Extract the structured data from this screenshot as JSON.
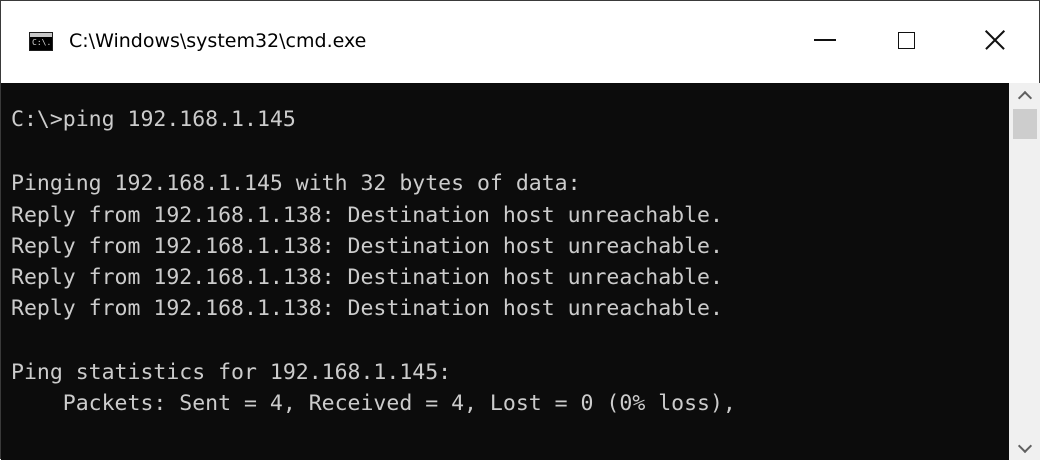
{
  "window": {
    "title": "C:\\Windows\\system32\\cmd.exe",
    "app_icon_text": "C:\\."
  },
  "controls": {
    "minimize": "minimize-icon",
    "maximize": "maximize-icon",
    "close": "close-icon"
  },
  "console": {
    "lines": [
      "C:\\>ping 192.168.1.145",
      "",
      "Pinging 192.168.1.145 with 32 bytes of data:",
      "Reply from 192.168.1.138: Destination host unreachable.",
      "Reply from 192.168.1.138: Destination host unreachable.",
      "Reply from 192.168.1.138: Destination host unreachable.",
      "Reply from 192.168.1.138: Destination host unreachable.",
      "",
      "Ping statistics for 192.168.1.145:",
      "    Packets: Sent = 4, Received = 4, Lost = 0 (0% loss),"
    ]
  },
  "colors": {
    "console_background": "#0c0c0c",
    "console_text": "#cccccc",
    "titlebar_background": "#ffffff"
  }
}
